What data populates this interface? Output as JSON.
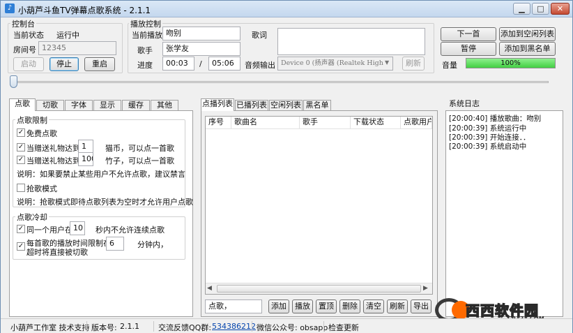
{
  "window": {
    "title": "小葫芦斗鱼TV弹幕点歌系统 - 2.1.1",
    "min": "▁",
    "max": "□",
    "close": "✕"
  },
  "control": {
    "title": "控制台",
    "status_label": "当前状态",
    "status_value": "运行中",
    "room_label": "房间号",
    "room_value": "12345",
    "start": "启动",
    "stop": "停止",
    "restart": "重启"
  },
  "playback": {
    "title": "播放控制",
    "current_label": "当前播放",
    "current_value": "吻别",
    "lyrics_label": "歌词",
    "singer_label": "歌手",
    "singer_value": "张学友",
    "progress_label": "进度",
    "time_current": "00:03",
    "time_sep": "/",
    "time_total": "05:06",
    "output_label": "音频输出",
    "output_value": "Device 0 (扬声器 (Realtek High",
    "refresh": "刷新"
  },
  "actions": {
    "next": "下一首",
    "add_idle": "添加到空闲列表",
    "pause": "暂停",
    "add_black": "添加到黑名单",
    "volume_label": "音量",
    "volume_value": "100%",
    "volume_fraction": 1.0
  },
  "left_tabs": [
    "点歌",
    "切歌",
    "字体",
    "显示",
    "缓存",
    "其他"
  ],
  "limits": {
    "title": "点歌限制",
    "free": "免费点歌",
    "gift1_pre": "当赠送礼物达到",
    "gift1_val": "1",
    "gift1_post": "猫币，可以点一首歌",
    "gift2_pre": "当赠送礼物达到",
    "gift2_val": "100",
    "gift2_post": "竹子，可以点一首歌",
    "note1": "说明：如果要禁止某些用户不允许点歌，建议禁言",
    "grab": "抢歌模式",
    "note2": "说明：抢歌模式即待点歌列表为空时才允许用户点歌"
  },
  "cooldown": {
    "title": "点歌冷却",
    "same_pre": "同一个用户在",
    "same_val": "10",
    "same_post": "秒内不允许连续点歌",
    "time_pre": "每首歌的播放时间限制在",
    "time_pre2": "超时将直接被切歌",
    "time_val": "6",
    "time_post": "分钟内，"
  },
  "list_tabs": [
    "点播列表",
    "已播列表",
    "空闲列表",
    "黑名单"
  ],
  "list_columns": [
    "序号",
    "歌曲名",
    "歌手",
    "下载状态",
    "点歌用户"
  ],
  "list_input": "点歌，",
  "list_buttons": [
    "添加",
    "播放",
    "置顶",
    "删除",
    "清空",
    "刷新",
    "导出"
  ],
  "log": {
    "title": "系统日志",
    "lines": [
      "[20:00:40] 播放歌曲：吻别",
      "[20:00:39] 系统运行中",
      "[20:00:39] 开始连接．．",
      "[20:00:39] 系统启动中"
    ]
  },
  "status": {
    "studio": "小葫芦工作室 技术支持",
    "version_label": "版本号:",
    "version": "2.1.1",
    "qq_label": "交流反馈QQ群:",
    "qq": "534386212",
    "wechat": "微信公众号: obsapp",
    "update": "检查更新"
  },
  "watermark": {
    "text": "西西软件园",
    "sub": "CR173.COM"
  }
}
